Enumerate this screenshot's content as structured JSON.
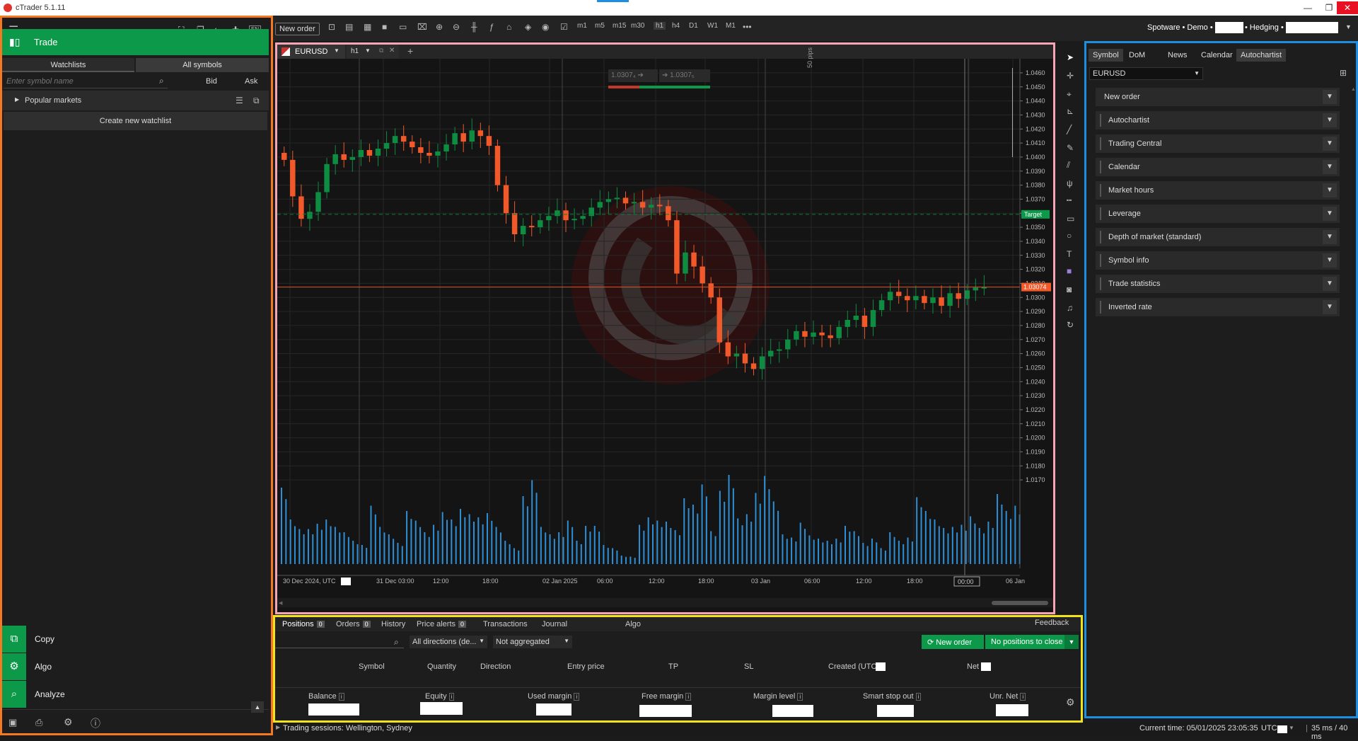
{
  "app": {
    "title": "cTrader 5.1.11"
  },
  "window_controls": {
    "minimize": "—",
    "restore": "❐",
    "close": "✕"
  },
  "left": {
    "trade_label": "Trade",
    "tabs": [
      "Watchlists",
      "All symbols"
    ],
    "search_placeholder": "Enter symbol name",
    "bid": "Bid",
    "ask": "Ask",
    "popular_markets": "Popular markets",
    "create_watchlist": "Create new watchlist",
    "nav": [
      "Copy",
      "Algo",
      "Analyze"
    ]
  },
  "toolbar": {
    "new_order": "New order",
    "timeframes": [
      "m1",
      "m5",
      "m15",
      "m30",
      "h1",
      "h4",
      "D1",
      "W1",
      "M1"
    ],
    "account": "Spotware • Demo •",
    "mode": "• Hedging •"
  },
  "chart_tab": {
    "symbol": "EURUSD",
    "timeframe": "h1"
  },
  "chart_data": {
    "type": "candlestick",
    "symbol": "EURUSD",
    "timeframe": "h1",
    "sell_price": "1.03074",
    "buy_price": "1.03075",
    "pips_label": "50 pips",
    "target_label": "Target",
    "current_price_label": "1.03074",
    "current_price": 1.03074,
    "target_price": 1.03592,
    "ylim": [
      1.0165,
      1.0465
    ],
    "yticks": [
      "1.0460",
      "1.0450",
      "1.0440",
      "1.0430",
      "1.0420",
      "1.0410",
      "1.0400",
      "1.0390",
      "1.0380",
      "1.0370",
      "1.0360",
      "1.0350",
      "1.0340",
      "1.0330",
      "1.0320",
      "1.0310",
      "1.0300",
      "1.0290",
      "1.0280",
      "1.0270",
      "1.0260",
      "1.0250",
      "1.0240",
      "1.0230",
      "1.0220",
      "1.0210",
      "1.0200",
      "1.0190",
      "1.0180",
      "1.0170"
    ],
    "xticks": [
      "30 Dec 2024, UTC",
      "31 Dec 03:00",
      "12:00",
      "18:00",
      "02 Jan 2025",
      "06:00",
      "12:00",
      "18:00",
      "03 Jan",
      "06:00",
      "12:00",
      "18:00",
      "00:00",
      "06 Jan"
    ],
    "candles_close": [
      1.0398,
      1.0372,
      1.0356,
      1.0361,
      1.0375,
      1.0395,
      1.0402,
      1.0398,
      1.04,
      1.0405,
      1.0401,
      1.0406,
      1.041,
      1.0415,
      1.0411,
      1.0407,
      1.0403,
      1.0401,
      1.0404,
      1.0409,
      1.0417,
      1.0411,
      1.0419,
      1.0415,
      1.0408,
      1.038,
      1.036,
      1.0345,
      1.0351,
      1.035,
      1.0355,
      1.0358,
      1.0362,
      1.0355,
      1.0356,
      1.0358,
      1.0364,
      1.0368,
      1.037,
      1.0371,
      1.0367,
      1.0368,
      1.0364,
      1.0366,
      1.0365,
      1.0355,
      1.0317,
      1.0332,
      1.0322,
      1.031,
      1.03,
      1.0268,
      1.0258,
      1.026,
      1.0253,
      1.0249,
      1.0258,
      1.0262,
      1.0263,
      1.027,
      1.0276,
      1.0272,
      1.0275,
      1.0273,
      1.0271,
      1.0279,
      1.0284,
      1.0287,
      1.0279,
      1.0291,
      1.0298,
      1.0304,
      1.0301,
      1.0298,
      1.0301,
      1.0296,
      1.03,
      1.0294,
      1.0303,
      1.0299,
      1.0305,
      1.0307,
      1.03074
    ],
    "volumes": [
      0.72,
      0.42,
      0.33,
      0.33,
      0.38,
      0.42,
      0.35,
      0.3,
      0.22,
      0.18,
      0.55,
      0.35,
      0.28,
      0.2,
      0.5,
      0.41,
      0.3,
      0.37,
      0.49,
      0.42,
      0.52,
      0.47,
      0.44,
      0.48,
      0.35,
      0.22,
      0.15,
      0.64,
      0.79,
      0.35,
      0.28,
      0.3,
      0.41,
      0.22,
      0.36,
      0.36,
      0.18,
      0.15,
      0.08,
      0.07,
      0.37,
      0.44,
      0.41,
      0.4,
      0.32,
      0.62,
      0.56,
      0.75,
      0.31,
      0.69,
      0.84,
      0.43,
      0.47,
      0.67,
      0.83,
      0.59,
      0.28,
      0.25,
      0.39,
      0.27,
      0.24,
      0.22,
      0.24,
      0.36,
      0.31,
      0.2,
      0.24,
      0.15,
      0.3,
      0.22,
      0.25,
      0.63,
      0.5,
      0.42,
      0.34,
      0.35,
      0.37,
      0.45,
      0.34,
      0.4,
      0.66,
      0.5,
      0.55
    ],
    "price_top_box": "1.0307",
    "time_marker": "00:00"
  },
  "bottom": {
    "tabs": [
      {
        "label": "Positions",
        "badge": "0"
      },
      {
        "label": "Orders",
        "badge": "0"
      },
      {
        "label": "History",
        "badge": ""
      },
      {
        "label": "Price alerts",
        "badge": "0"
      },
      {
        "label": "Transactions",
        "badge": ""
      },
      {
        "label": "Journal",
        "badge": ""
      },
      {
        "label": "Algo",
        "badge": ""
      }
    ],
    "feedback": "Feedback",
    "direction_filter": "All directions (de...",
    "aggregation": "Not aggregated",
    "new_order": "New order",
    "no_positions": "No positions to close",
    "columns": [
      "Symbol",
      "Quantity",
      "Direction",
      "Entry price",
      "TP",
      "SL",
      "Created (UTC",
      "Net"
    ],
    "summary": [
      "Balance",
      "Equity",
      "Used margin",
      "Free margin",
      "Margin level",
      "Smart stop out",
      "Unr. Net"
    ]
  },
  "right": {
    "tabs": [
      "Symbol",
      "DoM",
      "News",
      "Calendar",
      "Autochartist"
    ],
    "symbol_select": "EURUSD",
    "sections": [
      "New order",
      "Autochartist",
      "Trading Central",
      "Calendar",
      "Market hours",
      "Leverage",
      "Depth of market (standard)",
      "Symbol info",
      "Trade statistics",
      "Inverted rate"
    ]
  },
  "status": {
    "sessions": "Trading sessions: Wellington, Sydney",
    "current_time": "Current time:  05/01/2025 23:05:35",
    "utc": "UTC",
    "latency": "35 ms / 40 ms"
  },
  "colors": {
    "accent": "#0c9a4a",
    "bear": "#f2592a",
    "bull": "#0e8c42",
    "volume": "#2e8fd6"
  }
}
